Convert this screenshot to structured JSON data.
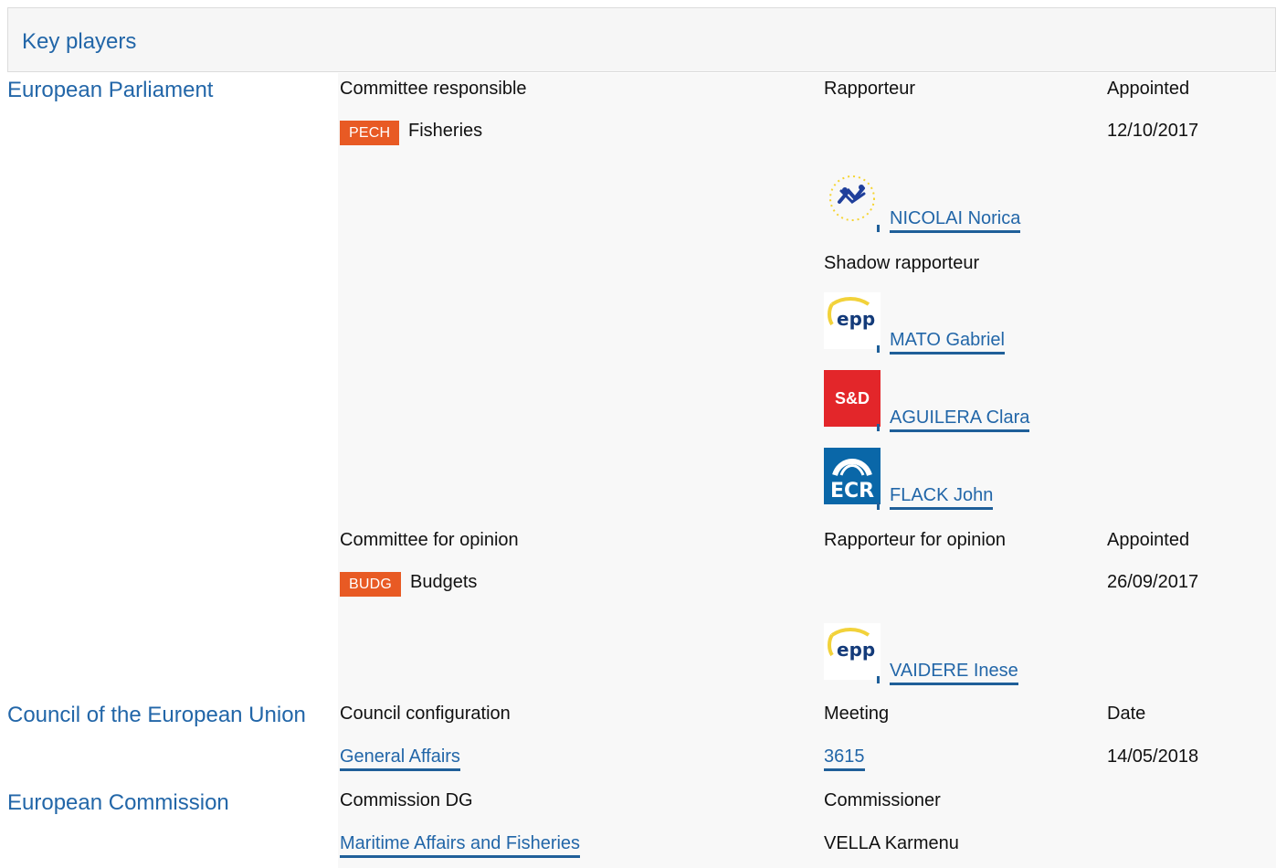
{
  "section": {
    "title": "Key players"
  },
  "bodies": {
    "ep": "European Parliament",
    "council": "Council of the European Union",
    "commission": "European Commission"
  },
  "ep_responsible": {
    "headers": {
      "committee": "Committee responsible",
      "rapporteur": "Rapporteur",
      "appointed": "Appointed"
    },
    "committee_code": "PECH",
    "committee_name": "Fisheries",
    "appointed_date": "12/10/2017",
    "rapporteur": {
      "name": "NICOLAI Norica",
      "group_icon": "alde-logo-icon"
    },
    "shadow_label": "Shadow rapporteur",
    "shadows": [
      {
        "name": "MATO Gabriel",
        "group_icon": "epp-logo-icon",
        "logo_text": "epp"
      },
      {
        "name": "AGUILERA Clara",
        "group_icon": "sd-logo-icon",
        "logo_text": "S&D"
      },
      {
        "name": "FLACK John",
        "group_icon": "ecr-logo-icon",
        "logo_text": "ECR"
      }
    ]
  },
  "ep_opinion": {
    "headers": {
      "committee": "Committee for opinion",
      "rapporteur": "Rapporteur for opinion",
      "appointed": "Appointed"
    },
    "committee_code": "BUDG",
    "committee_name": "Budgets",
    "appointed_date": "26/09/2017",
    "rapporteur": {
      "name": "VAIDERE Inese",
      "group_icon": "epp-logo-icon",
      "logo_text": "epp"
    }
  },
  "council": {
    "headers": {
      "config": "Council configuration",
      "meeting": "Meeting",
      "date": "Date"
    },
    "config": "General Affairs",
    "meeting": "3615",
    "date": "14/05/2018"
  },
  "commission": {
    "headers": {
      "dg": "Commission DG",
      "commissioner": "Commissioner"
    },
    "dg": "Maritime Affairs and Fisheries",
    "commissioner": "VELLA Karmenu"
  },
  "colors": {
    "link": "#2266a8",
    "badge": "#e85a24",
    "sd": "#e3262a",
    "ecr": "#0a67a8"
  }
}
